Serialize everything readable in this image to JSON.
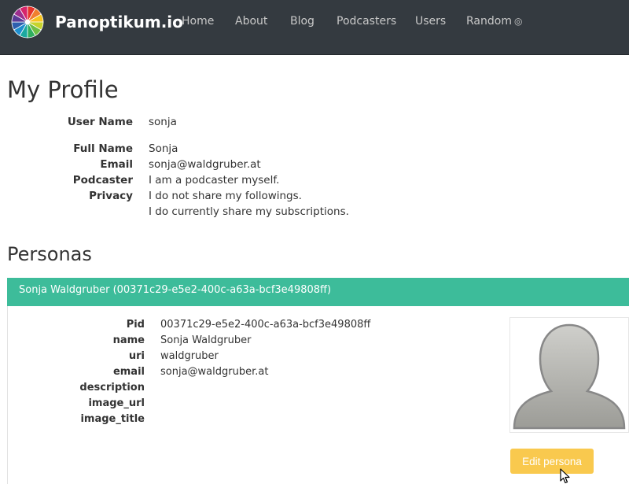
{
  "navbar": {
    "brand": "Panoptikum.io",
    "links": [
      {
        "label": "Home"
      },
      {
        "label": "About"
      },
      {
        "label": "Blog"
      },
      {
        "label": "Podcasters"
      },
      {
        "label": "Users"
      },
      {
        "label": "Random"
      }
    ]
  },
  "profile": {
    "title": "My Profile",
    "user_name_label": "User Name",
    "user_name": "sonja",
    "full_name_label": "Full Name",
    "full_name": "Sonja",
    "email_label": "Email",
    "email": "sonja@waldgruber.at",
    "podcaster_label": "Podcaster",
    "podcaster": "I am a podcaster myself.",
    "privacy_label": "Privacy",
    "privacy_line1": "I do not share my followings.",
    "privacy_line2": "I do currently share my subscriptions."
  },
  "personas": {
    "title": "Personas",
    "items": [
      {
        "header": "Sonja Waldgruber (00371c29-e5e2-400c-a63a-bcf3e49808ff)",
        "fields": [
          {
            "label": "Pid",
            "value": "00371c29-e5e2-400c-a63a-bcf3e49808ff"
          },
          {
            "label": "name",
            "value": "Sonja Waldgruber"
          },
          {
            "label": "uri",
            "value": "waldgruber"
          },
          {
            "label": "email",
            "value": "sonja@waldgruber.at"
          },
          {
            "label": "description",
            "value": ""
          },
          {
            "label": "image_url",
            "value": ""
          },
          {
            "label": "image_title",
            "value": ""
          }
        ],
        "edit_label": "Edit persona"
      }
    ]
  },
  "colors": {
    "navbar": "#343a40",
    "persona_header": "#3dbc9a",
    "edit_button": "#f9c94e"
  }
}
